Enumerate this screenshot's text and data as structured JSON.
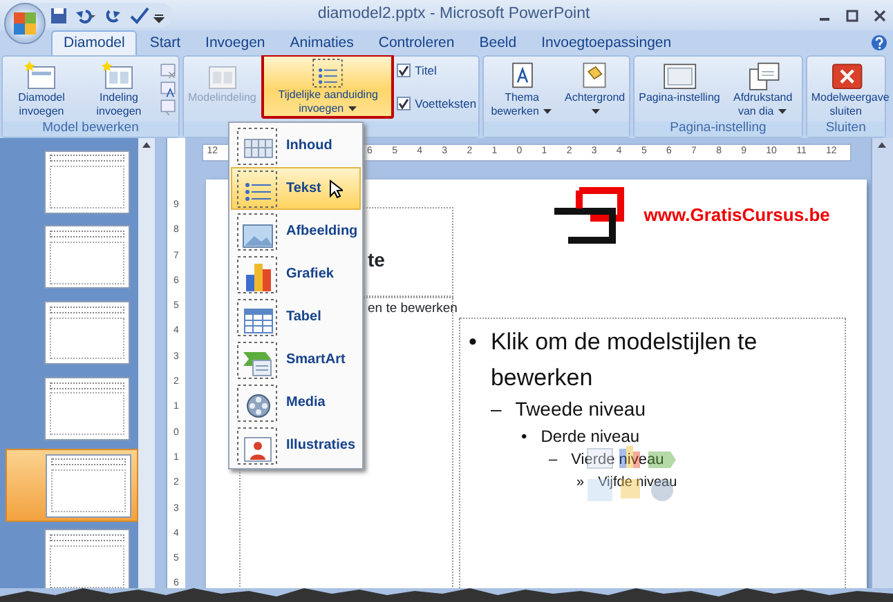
{
  "window": {
    "title": "diamodel2.pptx - Microsoft PowerPoint"
  },
  "tabs": [
    {
      "label": "Diamodel",
      "selected": true
    },
    {
      "label": "Start",
      "selected": false
    },
    {
      "label": "Invoegen",
      "selected": false
    },
    {
      "label": "Animaties",
      "selected": false
    },
    {
      "label": "Controleren",
      "selected": false
    },
    {
      "label": "Beeld",
      "selected": false
    },
    {
      "label": "Invoegtoepassingen",
      "selected": false
    }
  ],
  "ribbon": {
    "groups": [
      {
        "label": "Model bewerken",
        "buttons": [
          {
            "kind": "large",
            "label": "Diamodel invoegen",
            "disabled": false,
            "highlighted": false
          },
          {
            "kind": "large",
            "label": "Indeling invoegen",
            "disabled": false,
            "highlighted": false
          },
          {
            "kind": "small-stack"
          }
        ]
      },
      {
        "buttons": [
          {
            "kind": "large",
            "label": "Modelindeling",
            "disabled": true,
            "highlighted": false
          },
          {
            "kind": "large",
            "label": "Tijdelijke aanduiding invoegen",
            "dropdown": true,
            "disabled": false,
            "highlighted": true
          },
          {
            "kind": "checks",
            "items": [
              {
                "label": "Titel",
                "checked": true
              },
              {
                "label": "Voetteksten",
                "checked": true
              }
            ]
          }
        ]
      },
      {
        "buttons": [
          {
            "kind": "large",
            "label": "Thema bewerken",
            "dropdown": true,
            "disabled": false,
            "highlighted": false
          },
          {
            "kind": "large",
            "label": "Achtergrond",
            "dropdown": true,
            "disabled": false,
            "highlighted": false
          }
        ]
      },
      {
        "label": "Pagina-instelling",
        "buttons": [
          {
            "kind": "large",
            "label": "Pagina-instelling",
            "disabled": false,
            "highlighted": false
          },
          {
            "kind": "large",
            "label": "Afdrukstand van dia",
            "dropdown": true,
            "disabled": false,
            "highlighted": false
          }
        ]
      },
      {
        "label": "Sluiten",
        "buttons": [
          {
            "kind": "large",
            "label": "Modelweergave sluiten",
            "disabled": false,
            "highlighted": false
          }
        ]
      }
    ]
  },
  "dropdown_menu": {
    "items": [
      {
        "label": "Inhoud",
        "selected": false
      },
      {
        "label": "Tekst",
        "selected": true
      },
      {
        "label": "Afbeelding",
        "selected": false
      },
      {
        "label": "Grafiek",
        "selected": false
      },
      {
        "label": "Tabel",
        "selected": false
      },
      {
        "label": "SmartArt",
        "selected": false
      },
      {
        "label": "Media",
        "selected": false
      },
      {
        "label": "Illustraties",
        "selected": false
      }
    ]
  },
  "thumbnails": [
    {
      "selected": false
    },
    {
      "selected": false
    },
    {
      "selected": false
    },
    {
      "selected": false
    },
    {
      "selected": true
    },
    {
      "selected": false
    }
  ],
  "horizontal_ruler": {
    "left_text": "12",
    "right_text": "6 5 4 3 2 1 0 1 2 3 4 5 6 7 8 9 10 11 12"
  },
  "vertical_ruler": {
    "text": "9 8 7 6 5 4 3 2 1 0 1 2 3 4 5 6"
  },
  "slide": {
    "logo_text": "www.GratisCursus.be",
    "left_title_fragment": "te",
    "left_text_fragment": "en te bewerken",
    "bullets": [
      {
        "marker": "•",
        "text": "Klik om de modelstijlen te bewerken"
      },
      {
        "marker": "–",
        "text": "Tweede niveau"
      },
      {
        "marker": "•",
        "text": "Derde niveau"
      },
      {
        "marker": "–",
        "text": "Vierde niveau"
      },
      {
        "marker": "»",
        "text": "Vijfde niveau"
      }
    ]
  }
}
